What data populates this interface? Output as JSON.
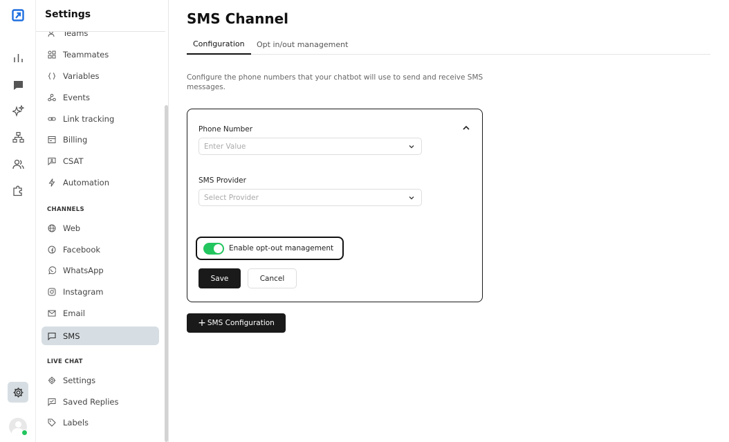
{
  "app": {
    "brand_color": "#1e6fe0",
    "accent_green": "#22c55e"
  },
  "rail": {
    "items": [
      {
        "name": "analytics",
        "icon": "bar-chart-icon"
      },
      {
        "name": "conversations",
        "icon": "chat-icon"
      },
      {
        "name": "ai",
        "icon": "sparkles-icon"
      },
      {
        "name": "flows",
        "icon": "sitemap-icon"
      },
      {
        "name": "contacts",
        "icon": "users-icon"
      },
      {
        "name": "integrations",
        "icon": "puzzle-icon"
      },
      {
        "name": "settings",
        "icon": "gear-icon",
        "active": true
      }
    ],
    "user_status": "online"
  },
  "sidebar": {
    "title": "Settings",
    "items": [
      {
        "label": "Teams",
        "icon": "users-icon"
      },
      {
        "label": "Teammates",
        "icon": "grid-icon"
      },
      {
        "label": "Variables",
        "icon": "braces-icon"
      },
      {
        "label": "Events",
        "icon": "webhook-icon"
      },
      {
        "label": "Link tracking",
        "icon": "link-icon"
      },
      {
        "label": "Billing",
        "icon": "receipt-icon"
      },
      {
        "label": "CSAT",
        "icon": "feedback-icon"
      },
      {
        "label": "Automation",
        "icon": "bolt-icon"
      }
    ],
    "channels_heading": "CHANNELS",
    "channels": [
      {
        "label": "Web",
        "icon": "globe-icon"
      },
      {
        "label": "Facebook",
        "icon": "facebook-icon"
      },
      {
        "label": "WhatsApp",
        "icon": "whatsapp-icon"
      },
      {
        "label": "Instagram",
        "icon": "instagram-icon"
      },
      {
        "label": "Email",
        "icon": "mail-icon"
      },
      {
        "label": "SMS",
        "icon": "message-square-icon",
        "active": true
      }
    ],
    "live_chat_heading": "LIVE CHAT",
    "live_chat": [
      {
        "label": "Settings",
        "icon": "gear-icon"
      },
      {
        "label": "Saved Replies",
        "icon": "saved-reply-icon"
      },
      {
        "label": "Labels",
        "icon": "tag-icon"
      }
    ]
  },
  "main": {
    "title": "SMS Channel",
    "tabs": [
      {
        "label": "Configuration",
        "active": true
      },
      {
        "label": "Opt in/out management",
        "active": false
      }
    ],
    "description": "Configure the phone numbers that your chatbot will use to send and receive SMS messages.",
    "form": {
      "phone_label": "Phone Number",
      "phone_placeholder": "Enter Value",
      "provider_label": "SMS Provider",
      "provider_placeholder": "Select Provider",
      "optout_label": "Enable opt-out management",
      "optout_enabled": true,
      "save_label": "Save",
      "cancel_label": "Cancel"
    },
    "add_button_label": "SMS Configuration"
  }
}
